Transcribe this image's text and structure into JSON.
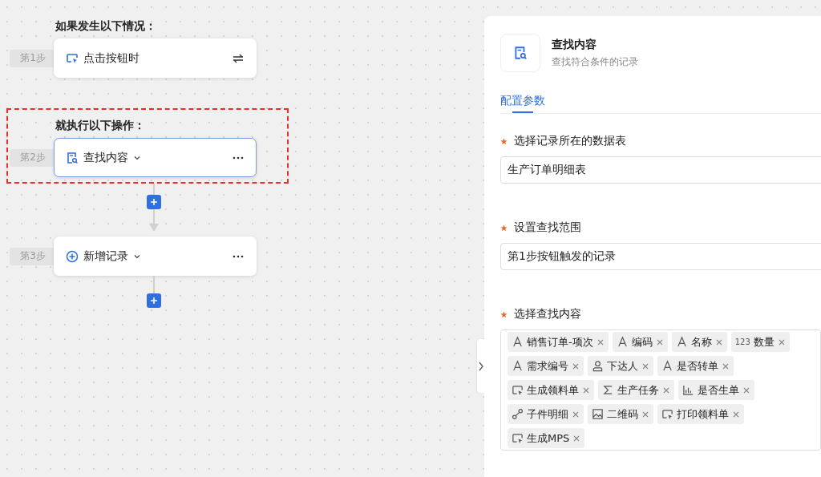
{
  "flow": {
    "groups": [
      {
        "heading": "如果发生以下情况：",
        "highlighted": false,
        "steps": [
          {
            "step_label": "第1步",
            "title": "点击按钮时",
            "kind": "trigger",
            "selected": false,
            "dropdown": false
          }
        ]
      },
      {
        "heading": "就执行以下操作：",
        "highlighted": true,
        "steps": [
          {
            "step_label": "第2步",
            "title": "查找内容",
            "kind": "find",
            "selected": true,
            "dropdown": true
          },
          {
            "step_label": "第3步",
            "title": "新增记录",
            "kind": "add",
            "selected": false,
            "dropdown": true
          }
        ]
      }
    ]
  },
  "panel": {
    "title": "查找内容",
    "subtitle": "查找符合条件的记录",
    "tabs": [
      {
        "label": "配置参数",
        "selected": true
      }
    ],
    "fields": [
      {
        "kind": "select",
        "label": "选择记录所在的数据表",
        "required": true,
        "value": "生产订单明细表"
      },
      {
        "kind": "select",
        "label": "设置查找范围",
        "required": true,
        "value": "第1步按钮触发的记录"
      },
      {
        "kind": "tags",
        "label": "选择查找内容",
        "required": true,
        "tags": [
          {
            "kind": "text",
            "label": "销售订单-项次"
          },
          {
            "kind": "text",
            "label": "编码"
          },
          {
            "kind": "text",
            "label": "名称"
          },
          {
            "kind": "number",
            "type_label": "123",
            "label": "数量"
          },
          {
            "kind": "text",
            "label": "需求编号"
          },
          {
            "kind": "person",
            "label": "下达人"
          },
          {
            "kind": "text",
            "label": "是否转单"
          },
          {
            "kind": "button",
            "label": "生成领料单"
          },
          {
            "kind": "sum",
            "label": "生产任务"
          },
          {
            "kind": "chart",
            "label": "是否生单"
          },
          {
            "kind": "relation",
            "label": "子件明细"
          },
          {
            "kind": "image",
            "label": "二维码"
          },
          {
            "kind": "button",
            "label": "打印领料单"
          },
          {
            "kind": "button",
            "label": "生成MPS"
          }
        ]
      }
    ]
  }
}
